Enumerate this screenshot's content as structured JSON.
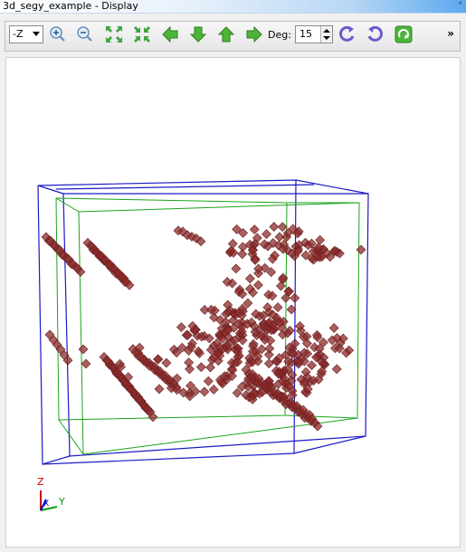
{
  "window": {
    "title": "3d_segy_example - Display",
    "close_glyph": "ˣ"
  },
  "toolbar": {
    "view_select": {
      "value": "-Z",
      "options": [
        "-Z"
      ]
    },
    "icons": [
      "zoom-in-icon",
      "zoom-out-icon",
      "fit-view-icon",
      "shrink-view-icon",
      "arrow-left-icon",
      "arrow-down-icon",
      "arrow-up-icon",
      "arrow-right-icon"
    ],
    "deg_label": "Deg:",
    "deg_value": "15",
    "rotate_icons": [
      "rotate-ccw-icon",
      "rotate-cw-icon",
      "reset-view-icon"
    ],
    "overflow": "»"
  },
  "scene": {
    "voxel_color": "#8b2a2a",
    "voxel_edge": "#6a1f1f",
    "outer_box_color": "#1a1ac8",
    "inner_box_color": "#1aa31a"
  },
  "axes": {
    "z": "Z",
    "x": "X",
    "y": "Y",
    "z_color": "#cc0000",
    "y_color": "#00a000",
    "x_color": "#0000cc"
  }
}
